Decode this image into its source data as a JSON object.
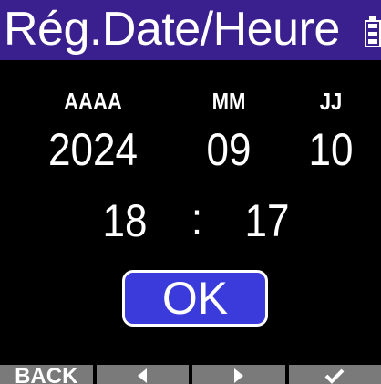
{
  "header": {
    "title": "Rég.Date/Heure",
    "battery_icon": "battery-full-icon",
    "background_color": "#3a1f8e"
  },
  "date": {
    "year_label": "AAAA",
    "month_label": "MM",
    "day_label": "JJ",
    "year": "2024",
    "month": "09",
    "day": "10"
  },
  "time": {
    "hour": "18",
    "separator": ":",
    "minute": "17"
  },
  "ok_button": {
    "label": "OK",
    "color": "#3b3bdc"
  },
  "softkeys": {
    "back_label": "BACK",
    "left_icon": "arrow-left-icon",
    "right_icon": "arrow-right-icon",
    "confirm_icon": "checkmark-icon",
    "color": "#7a7a7a"
  }
}
